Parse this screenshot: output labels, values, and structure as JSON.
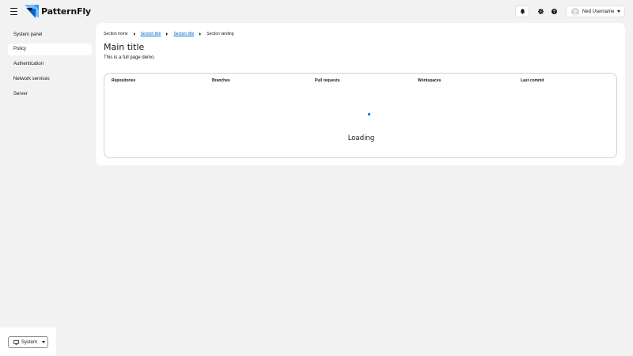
{
  "masthead": {
    "brand": "PatternFly",
    "user_name": "Ned Username",
    "icons": [
      "bars-icon",
      "bell-icon",
      "cog-icon",
      "question-circle-icon",
      "caret-down-icon"
    ]
  },
  "sidebar": {
    "items": [
      {
        "label": "System panel",
        "current": false
      },
      {
        "label": "Policy",
        "current": true
      },
      {
        "label": "Authentication",
        "current": false
      },
      {
        "label": "Network services",
        "current": false
      },
      {
        "label": "Server",
        "current": false
      }
    ],
    "theme_button": {
      "label": "System",
      "icon": "desktop-icon"
    }
  },
  "breadcrumb": [
    {
      "label": "Section home",
      "link": false
    },
    {
      "label": "Section title",
      "link": true
    },
    {
      "label": "Section title",
      "link": true
    },
    {
      "label": "Section landing",
      "link": false
    }
  ],
  "page": {
    "title": "Main title",
    "description": "This is a full page demo."
  },
  "table": {
    "columns": [
      "Repositories",
      "Branches",
      "Pull requests",
      "Workspaces",
      "Last commit"
    ],
    "state_text": "Loading"
  },
  "colors": {
    "background": "#f2f2f2",
    "link": "#0066cc",
    "spinner": "#0066cc",
    "brand_blue": "#2b9af3"
  }
}
